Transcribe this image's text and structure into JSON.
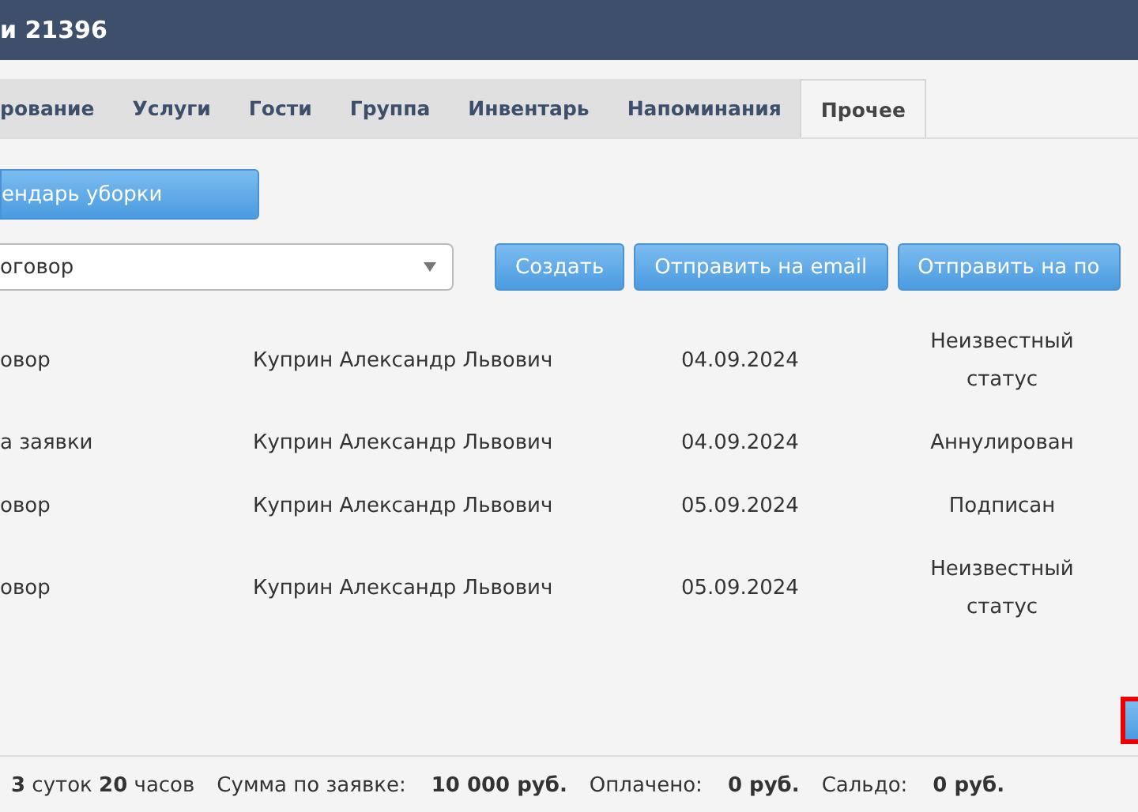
{
  "window": {
    "title": "и 21396"
  },
  "tabs": [
    {
      "label": "рование",
      "selected": false
    },
    {
      "label": "Услуги",
      "selected": false
    },
    {
      "label": "Гости",
      "selected": false
    },
    {
      "label": "Группа",
      "selected": false
    },
    {
      "label": "Инвентарь",
      "selected": false
    },
    {
      "label": "Напоминания",
      "selected": false
    },
    {
      "label": "Прочее",
      "selected": true
    }
  ],
  "calendar_button": "ендарь уборки",
  "document_select": {
    "value": "оговор"
  },
  "actions": [
    "Создать",
    "Отправить на email",
    "Отправить на по"
  ],
  "documents": [
    {
      "column_1": "овор",
      "person": "Куприн Александр Львович",
      "date": "04.09.2024",
      "status": "Неизвестный статус"
    },
    {
      "column_1": "а заявки",
      "person": "Куприн Александр Львович",
      "date": "04.09.2024",
      "status": "Аннулирован"
    },
    {
      "column_1": "овор",
      "person": "Куприн Александр Львович",
      "date": "05.09.2024",
      "status": "Подписан"
    },
    {
      "column_1": "овор",
      "person": "Куприн Александр Львович",
      "date": "05.09.2024",
      "status": "Неизвестный статус"
    }
  ],
  "partial_button": {
    "outlined": true
  },
  "status_bar": {
    "duration": "**3** суток **20** часов",
    "total_label": "Сумма по заявке:",
    "total": "10 000 руб.",
    "paid_label": "Оплачено:",
    "paid": "0 руб.",
    "balance_label": "Сальдо:",
    "balance": "0 руб."
  }
}
